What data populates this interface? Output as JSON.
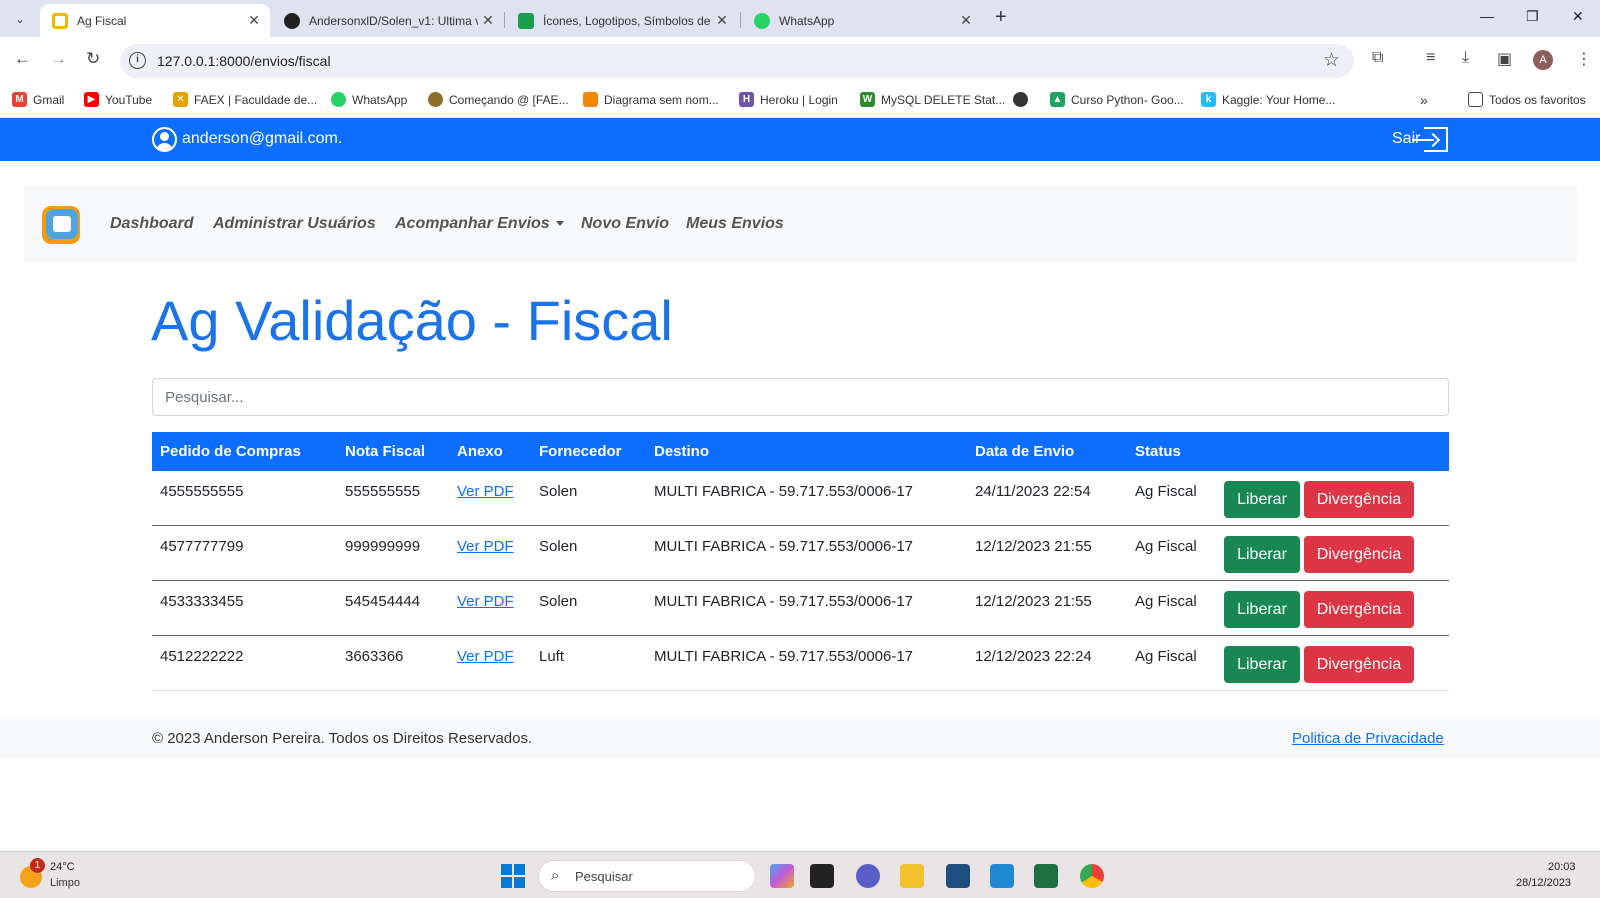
{
  "browser": {
    "tabs": [
      {
        "title": "Ag Fiscal",
        "color": "#f4b400"
      },
      {
        "title": "AndersonxlD/Solen_v1: Ultima v",
        "color": "#222222"
      },
      {
        "title": "Ícones, Logotipos, Símbolos de",
        "color": "#1a9e4b"
      },
      {
        "title": "WhatsApp",
        "color": "#25d366"
      }
    ],
    "url": "127.0.0.1:8000/envios/fiscal",
    "avatar_letter": "A",
    "bookmarks": [
      {
        "label": "Gmail",
        "color": "#ea4335"
      },
      {
        "label": "YouTube",
        "color": "#ff0000"
      },
      {
        "label": "FAEX | Faculdade de...",
        "color": "#e8a000"
      },
      {
        "label": "WhatsApp",
        "color": "#25d366"
      },
      {
        "label": "Começando @ [FAE...",
        "color": "#8b6f2a"
      },
      {
        "label": "Diagrama sem nom...",
        "color": "#f08705"
      },
      {
        "label": "Heroku | Login",
        "color": "#6f54a8"
      },
      {
        "label": "MySQL DELETE Stat...",
        "color": "#2e8b2e"
      },
      {
        "label": "",
        "color": "#333333"
      },
      {
        "label": "Curso Python- Goo...",
        "color": "#1fa463"
      },
      {
        "label": "Kaggle: Your Home...",
        "color": "#20beff"
      }
    ],
    "all_bookmarks": "Todos os favoritos"
  },
  "header": {
    "user_email": "anderson@gmail.com.",
    "logout_label": "Sair"
  },
  "nav": {
    "items": [
      "Dashboard",
      "Administrar Usuários",
      "Acompanhar Envios",
      "Novo Envio",
      "Meus Envios"
    ]
  },
  "page": {
    "title": "Ag Validação - Fiscal",
    "search_placeholder": "Pesquisar..."
  },
  "table": {
    "columns": [
      "Pedido de Compras",
      "Nota Fiscal",
      "Anexo",
      "Fornecedor",
      "Destino",
      "Data de Envio",
      "Status"
    ],
    "rows": [
      {
        "pedido": "4555555555",
        "nota": "555555555",
        "anexo": "Ver PDF",
        "fornecedor": "Solen",
        "destino": "MULTI FABRICA - 59.717.553/0006-17",
        "data": "24/11/2023 22:54",
        "status": "Ag Fiscal",
        "liberar": "Liberar",
        "divergencia": "Divergência"
      },
      {
        "pedido": "4577777799",
        "nota": "999999999",
        "anexo": "Ver PDF",
        "fornecedor": "Solen",
        "destino": "MULTI FABRICA - 59.717.553/0006-17",
        "data": "12/12/2023 21:55",
        "status": "Ag Fiscal",
        "liberar": "Liberar",
        "divergencia": "Divergência"
      },
      {
        "pedido": "4533333455",
        "nota": "545454444",
        "anexo": "Ver PDF",
        "fornecedor": "Solen",
        "destino": "MULTI FABRICA - 59.717.553/0006-17",
        "data": "12/12/2023 21:55",
        "status": "Ag Fiscal",
        "liberar": "Liberar",
        "divergencia": "Divergência"
      },
      {
        "pedido": "4512222222",
        "nota": "3663366",
        "anexo": "Ver PDF",
        "fornecedor": "Luft",
        "destino": "MULTI FABRICA - 59.717.553/0006-17",
        "data": "12/12/2023 22:24",
        "status": "Ag Fiscal",
        "liberar": "Liberar",
        "divergencia": "Divergência"
      }
    ]
  },
  "footer": {
    "copyright": "© 2023 Anderson Pereira. Todos os Direitos Reservados.",
    "privacy": "Politica de Privacidade"
  },
  "taskbar": {
    "weather_badge": "1",
    "temperature": "24°C",
    "condition": "Limpo",
    "search_label": "Pesquisar",
    "time": "20:03",
    "date": "28/12/2023"
  },
  "colors": {
    "primary": "#0d6efd",
    "success": "#198754",
    "danger": "#dc3545"
  }
}
